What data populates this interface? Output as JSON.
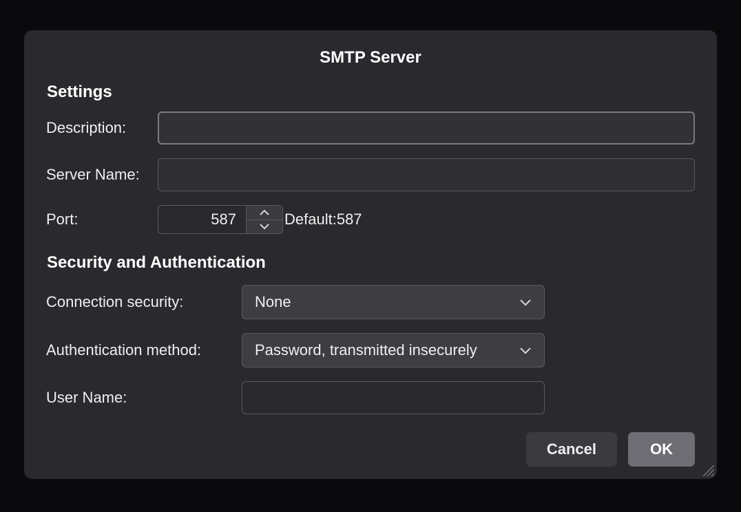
{
  "dialog": {
    "title": "SMTP Server"
  },
  "settings": {
    "heading": "Settings",
    "description_label": "Description:",
    "description_value": "",
    "server_name_label": "Server Name:",
    "server_name_value": "",
    "port_label": "Port:",
    "port_value": "587",
    "port_default_label": "Default:",
    "port_default_value": "587"
  },
  "security": {
    "heading": "Security and Authentication",
    "connection_security_label": "Connection security:",
    "connection_security_value": "None",
    "auth_method_label": "Authentication method:",
    "auth_method_value": "Password, transmitted insecurely",
    "username_label": "User Name:",
    "username_value": ""
  },
  "buttons": {
    "cancel": "Cancel",
    "ok": "OK"
  }
}
